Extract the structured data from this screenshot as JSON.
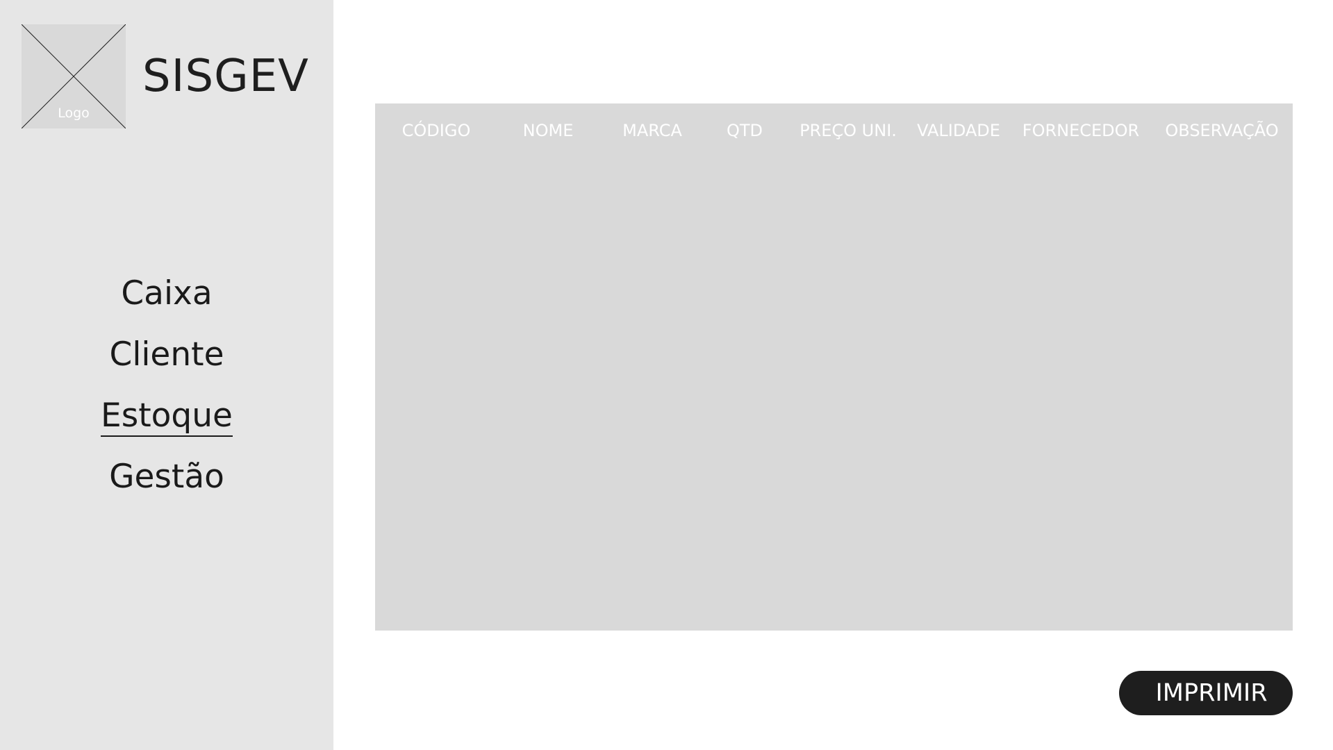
{
  "app": {
    "brand": "SISGEV",
    "logo_label": "Logo"
  },
  "nav": {
    "items": [
      {
        "label": "Caixa"
      },
      {
        "label": "Cliente"
      },
      {
        "label": "Estoque"
      },
      {
        "label": "Gestão"
      }
    ],
    "active": "Estoque"
  },
  "table": {
    "columns": [
      "CÓDIGO",
      "NOME",
      "MARCA",
      "QTD",
      "PREÇO UNI.",
      "VALIDADE",
      "FORNECEDOR",
      "OBSERVAÇÃO"
    ],
    "rows": []
  },
  "actions": {
    "print_label": "IMPRIMIR"
  },
  "colors": {
    "sidebar_bg": "#e6e6e6",
    "panel_bg": "#d9d9d9",
    "button_bg": "#1e1e1e",
    "header_text": "#ffffff"
  }
}
